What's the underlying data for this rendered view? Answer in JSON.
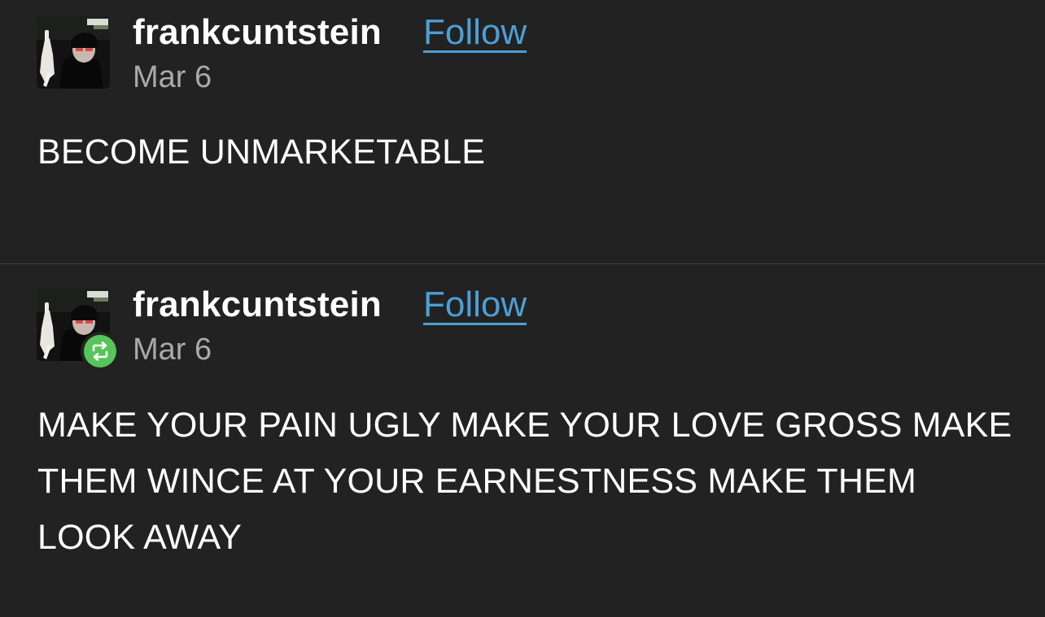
{
  "posts": [
    {
      "username": "frankcuntstein",
      "follow_label": "Follow",
      "date": "Mar 6",
      "body": "BECOME UNMARKETABLE",
      "reblogged": false,
      "avatar_icon": "profile-photo"
    },
    {
      "username": "frankcuntstein",
      "follow_label": "Follow",
      "date": "Mar 6",
      "body": "MAKE YOUR PAIN UGLY MAKE YOUR LOVE GROSS MAKE THEM WINCE AT YOUR EARNESTNESS MAKE THEM LOOK AWAY",
      "reblogged": true,
      "avatar_icon": "profile-photo",
      "badge_icon": "reblog-icon"
    }
  ],
  "colors": {
    "background": "#222222",
    "link": "#4c9fd5",
    "date": "#a9a9a9",
    "reblog_badge": "#57c55a",
    "divider": "#3e3e3e"
  }
}
